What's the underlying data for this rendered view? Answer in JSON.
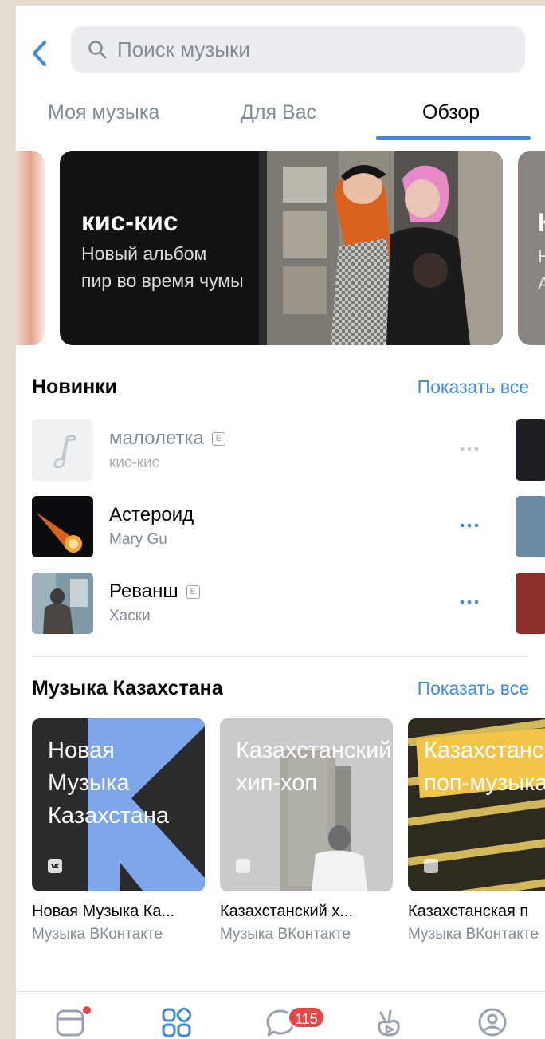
{
  "search": {
    "placeholder": "Поиск музыки"
  },
  "tabs": [
    {
      "label": "Моя музыка",
      "active": false
    },
    {
      "label": "Для Вас",
      "active": false
    },
    {
      "label": "Обзор",
      "active": true
    }
  ],
  "banner": {
    "title": "кис-кис",
    "subtitle_line1": "Новый альбом",
    "subtitle_line2": "пир во время чумы",
    "next_title": "К",
    "next_sub1": "Н",
    "next_sub2": "А"
  },
  "new_releases": {
    "title": "Новинки",
    "show_all": "Показать все",
    "tracks": [
      {
        "name": "малолетка",
        "artist": "кис-кис",
        "explicit": true,
        "explicit_mark": "E"
      },
      {
        "name": "Астероид",
        "artist": "Mary Gu",
        "explicit": false
      },
      {
        "name": "Реванш",
        "artist": "Хаски",
        "explicit": true,
        "explicit_mark": "E"
      }
    ]
  },
  "kazakhstan": {
    "title": "Музыка Казахстана",
    "show_all": "Показать все",
    "playlists": [
      {
        "art_line1": "Новая",
        "art_line2": "Музыка",
        "art_line3": "Казахстана",
        "title": "Новая Музыка Ка...",
        "subtitle": "Музыка ВКонтакте"
      },
      {
        "art_line1": "Казахстанский",
        "art_line2": "хип-хоп",
        "title": "Казахстанский х...",
        "subtitle": "Музыка ВКонтакте"
      },
      {
        "art_line1": "Казахстанская",
        "art_line2": "поп-музыка",
        "title": "Казахстанская п",
        "subtitle": "Музыка ВКонтакте"
      }
    ]
  },
  "tabbar": {
    "messages_badge": "115"
  },
  "colors": {
    "accent": "#3f8ae0",
    "badge": "#e64646",
    "secondary_text": "#818c99"
  }
}
